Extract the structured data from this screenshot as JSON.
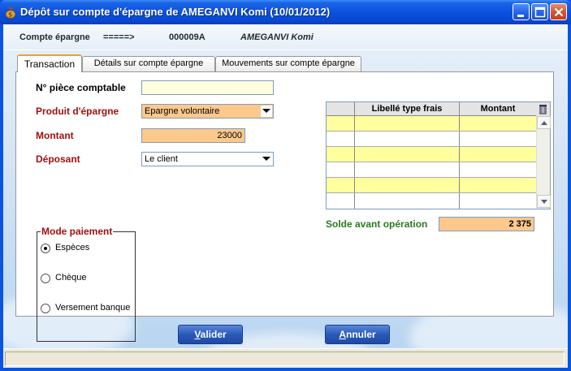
{
  "window": {
    "title": "Dépôt sur compte d'épargne de AMEGANVI Komi (10/01/2012)",
    "accent": "#0a54e0"
  },
  "info": {
    "label": "Compte épargne",
    "arrow": "=====>",
    "number": "000009A",
    "holder": "AMEGANVI Komi"
  },
  "tabs": [
    {
      "label": "Transaction",
      "active": true
    },
    {
      "label": "Détails sur compte épargne",
      "active": false
    },
    {
      "label": "Mouvements sur compte épargne",
      "active": false
    }
  ],
  "form": {
    "piece_label": "N° pièce comptable",
    "piece_value": "",
    "produit_label": "Produit d'épargne",
    "produit_value": "Epargne volontaire",
    "montant_label": "Montant",
    "montant_value": "23000",
    "deposant_label": "Déposant",
    "deposant_value": "Le client"
  },
  "grid": {
    "columns": [
      "",
      "Libellé type frais",
      "Montant"
    ],
    "rows": [
      [
        "",
        "",
        ""
      ],
      [
        "",
        "",
        ""
      ],
      [
        "",
        "",
        ""
      ],
      [
        "",
        "",
        ""
      ],
      [
        "",
        "",
        ""
      ],
      [
        "",
        "",
        ""
      ]
    ]
  },
  "solde": {
    "label": "Solde avant opération",
    "value": "2 375"
  },
  "payment": {
    "title": "Mode paiement",
    "options": [
      {
        "label": "Espèces",
        "selected": true
      },
      {
        "label": "Chèque",
        "selected": false
      },
      {
        "label": "Versement banque",
        "selected": false
      }
    ]
  },
  "buttons": {
    "valider_first": "V",
    "valider_rest": "alider",
    "annuler_first": "A",
    "annuler_rest": "nnuler"
  },
  "icons": {
    "app": "money-bag-icon",
    "minimize": "minimize-icon",
    "maximize": "maximize-icon",
    "close": "close-icon",
    "grid_delete": "trash-icon"
  }
}
